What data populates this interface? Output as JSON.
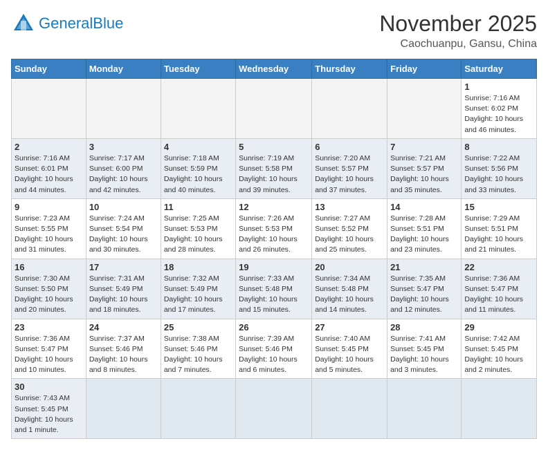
{
  "header": {
    "logo_general": "General",
    "logo_blue": "Blue",
    "month_title": "November 2025",
    "location": "Caochuanpu, Gansu, China"
  },
  "weekdays": [
    "Sunday",
    "Monday",
    "Tuesday",
    "Wednesday",
    "Thursday",
    "Friday",
    "Saturday"
  ],
  "weeks": [
    [
      {
        "day": "",
        "info": ""
      },
      {
        "day": "",
        "info": ""
      },
      {
        "day": "",
        "info": ""
      },
      {
        "day": "",
        "info": ""
      },
      {
        "day": "",
        "info": ""
      },
      {
        "day": "",
        "info": ""
      },
      {
        "day": "1",
        "info": "Sunrise: 7:16 AM\nSunset: 6:02 PM\nDaylight: 10 hours and 46 minutes."
      }
    ],
    [
      {
        "day": "2",
        "info": "Sunrise: 7:16 AM\nSunset: 6:01 PM\nDaylight: 10 hours and 44 minutes."
      },
      {
        "day": "3",
        "info": "Sunrise: 7:17 AM\nSunset: 6:00 PM\nDaylight: 10 hours and 42 minutes."
      },
      {
        "day": "4",
        "info": "Sunrise: 7:18 AM\nSunset: 5:59 PM\nDaylight: 10 hours and 40 minutes."
      },
      {
        "day": "5",
        "info": "Sunrise: 7:19 AM\nSunset: 5:58 PM\nDaylight: 10 hours and 39 minutes."
      },
      {
        "day": "6",
        "info": "Sunrise: 7:20 AM\nSunset: 5:57 PM\nDaylight: 10 hours and 37 minutes."
      },
      {
        "day": "7",
        "info": "Sunrise: 7:21 AM\nSunset: 5:57 PM\nDaylight: 10 hours and 35 minutes."
      },
      {
        "day": "8",
        "info": "Sunrise: 7:22 AM\nSunset: 5:56 PM\nDaylight: 10 hours and 33 minutes."
      }
    ],
    [
      {
        "day": "9",
        "info": "Sunrise: 7:23 AM\nSunset: 5:55 PM\nDaylight: 10 hours and 31 minutes."
      },
      {
        "day": "10",
        "info": "Sunrise: 7:24 AM\nSunset: 5:54 PM\nDaylight: 10 hours and 30 minutes."
      },
      {
        "day": "11",
        "info": "Sunrise: 7:25 AM\nSunset: 5:53 PM\nDaylight: 10 hours and 28 minutes."
      },
      {
        "day": "12",
        "info": "Sunrise: 7:26 AM\nSunset: 5:53 PM\nDaylight: 10 hours and 26 minutes."
      },
      {
        "day": "13",
        "info": "Sunrise: 7:27 AM\nSunset: 5:52 PM\nDaylight: 10 hours and 25 minutes."
      },
      {
        "day": "14",
        "info": "Sunrise: 7:28 AM\nSunset: 5:51 PM\nDaylight: 10 hours and 23 minutes."
      },
      {
        "day": "15",
        "info": "Sunrise: 7:29 AM\nSunset: 5:51 PM\nDaylight: 10 hours and 21 minutes."
      }
    ],
    [
      {
        "day": "16",
        "info": "Sunrise: 7:30 AM\nSunset: 5:50 PM\nDaylight: 10 hours and 20 minutes."
      },
      {
        "day": "17",
        "info": "Sunrise: 7:31 AM\nSunset: 5:49 PM\nDaylight: 10 hours and 18 minutes."
      },
      {
        "day": "18",
        "info": "Sunrise: 7:32 AM\nSunset: 5:49 PM\nDaylight: 10 hours and 17 minutes."
      },
      {
        "day": "19",
        "info": "Sunrise: 7:33 AM\nSunset: 5:48 PM\nDaylight: 10 hours and 15 minutes."
      },
      {
        "day": "20",
        "info": "Sunrise: 7:34 AM\nSunset: 5:48 PM\nDaylight: 10 hours and 14 minutes."
      },
      {
        "day": "21",
        "info": "Sunrise: 7:35 AM\nSunset: 5:47 PM\nDaylight: 10 hours and 12 minutes."
      },
      {
        "day": "22",
        "info": "Sunrise: 7:36 AM\nSunset: 5:47 PM\nDaylight: 10 hours and 11 minutes."
      }
    ],
    [
      {
        "day": "23",
        "info": "Sunrise: 7:36 AM\nSunset: 5:47 PM\nDaylight: 10 hours and 10 minutes."
      },
      {
        "day": "24",
        "info": "Sunrise: 7:37 AM\nSunset: 5:46 PM\nDaylight: 10 hours and 8 minutes."
      },
      {
        "day": "25",
        "info": "Sunrise: 7:38 AM\nSunset: 5:46 PM\nDaylight: 10 hours and 7 minutes."
      },
      {
        "day": "26",
        "info": "Sunrise: 7:39 AM\nSunset: 5:46 PM\nDaylight: 10 hours and 6 minutes."
      },
      {
        "day": "27",
        "info": "Sunrise: 7:40 AM\nSunset: 5:45 PM\nDaylight: 10 hours and 5 minutes."
      },
      {
        "day": "28",
        "info": "Sunrise: 7:41 AM\nSunset: 5:45 PM\nDaylight: 10 hours and 3 minutes."
      },
      {
        "day": "29",
        "info": "Sunrise: 7:42 AM\nSunset: 5:45 PM\nDaylight: 10 hours and 2 minutes."
      }
    ],
    [
      {
        "day": "30",
        "info": "Sunrise: 7:43 AM\nSunset: 5:45 PM\nDaylight: 10 hours and 1 minute."
      },
      {
        "day": "",
        "info": ""
      },
      {
        "day": "",
        "info": ""
      },
      {
        "day": "",
        "info": ""
      },
      {
        "day": "",
        "info": ""
      },
      {
        "day": "",
        "info": ""
      },
      {
        "day": "",
        "info": ""
      }
    ]
  ]
}
